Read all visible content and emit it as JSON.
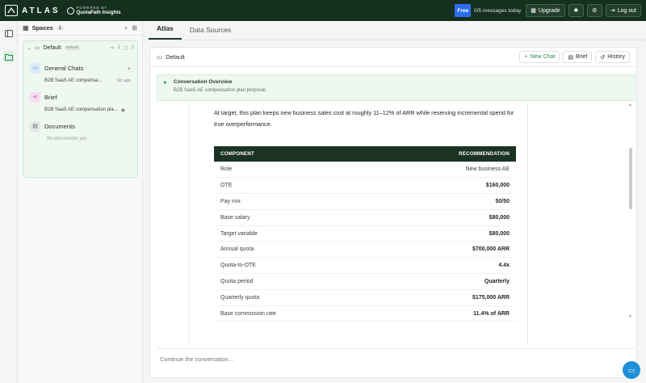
{
  "brand": {
    "name": "ATLAS",
    "powered_top": "POWERED BY",
    "powered_bottom": "QuotaPath Insights"
  },
  "header": {
    "plan_badge": "Free",
    "message_count": "0/5 messages today",
    "upgrade_label": "Upgrade",
    "logout_label": "Log out"
  },
  "spaces": {
    "title": "Spaces",
    "count": "1",
    "space": {
      "name": "Default",
      "badge": "Default",
      "link_count": "1",
      "chat_count": "1"
    },
    "sections": {
      "general_chats": {
        "label": "General Chats",
        "item": "B2B SaaS AE compensa...",
        "ago": "6d ago"
      },
      "brief": {
        "label": "Brief",
        "item": "B2B SaaS AE compensation pla..."
      },
      "documents": {
        "label": "Documents",
        "empty": "No documents yet."
      }
    }
  },
  "tabs": [
    {
      "label": "Atlas",
      "active": true
    },
    {
      "label": "Data Sources",
      "active": false
    }
  ],
  "workspace": {
    "folder": "Default",
    "new_chat": "New Chat",
    "brief": "Brief",
    "history": "History"
  },
  "overview": {
    "title": "Conversation Overview",
    "subtitle": "B2B SaaS AE compensation plan proposal."
  },
  "document": {
    "intro": "At target, this plan keeps new business sales cost at roughly 11–12% of ARR while reserving incremental spend for true overperformance.",
    "table": {
      "headers": [
        "COMPONENT",
        "RECOMMENDATION"
      ],
      "rows": [
        [
          "Role",
          "New business AE"
        ],
        [
          "OTE",
          "$160,000"
        ],
        [
          "Pay mix",
          "50/50"
        ],
        [
          "Base salary",
          "$80,000"
        ],
        [
          "Target variable",
          "$80,000"
        ],
        [
          "Annual quota",
          "$700,000 ARR"
        ],
        [
          "Quota-to-OTE",
          "4.4x"
        ],
        [
          "Quota period",
          "Quarterly"
        ],
        [
          "Quarterly quota",
          "$175,000 ARR"
        ],
        [
          "Base commission rate",
          "11.4% of ARR"
        ]
      ]
    }
  },
  "composer": {
    "placeholder": "Continue the conversation..."
  }
}
